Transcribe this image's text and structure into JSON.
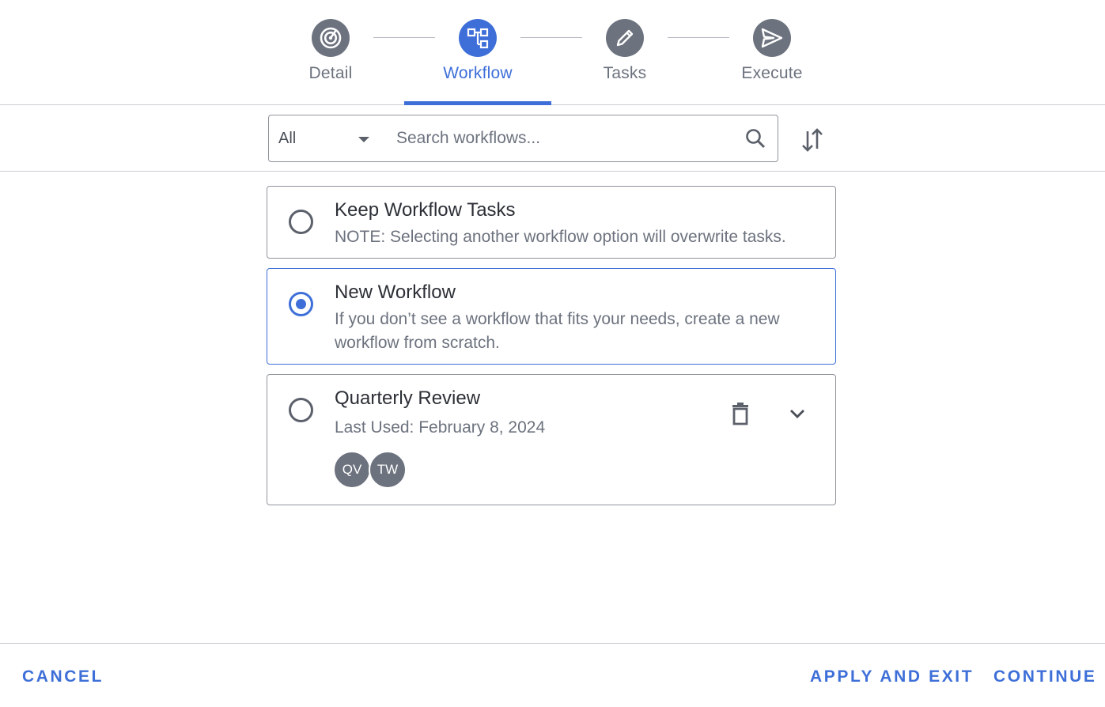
{
  "stepper": {
    "steps": [
      {
        "label": "Detail",
        "icon": "target-icon"
      },
      {
        "label": "Workflow",
        "icon": "workflow-icon"
      },
      {
        "label": "Tasks",
        "icon": "pencil-icon"
      },
      {
        "label": "Execute",
        "icon": "send-icon"
      }
    ],
    "active_step": "Workflow"
  },
  "toolbar": {
    "filter_value": "All",
    "search_placeholder": "Search workflows...",
    "search_value": ""
  },
  "options": [
    {
      "title": "Keep Workflow Tasks",
      "description": "NOTE: Selecting another workflow option will overwrite tasks.",
      "selected": false
    },
    {
      "title": "New Workflow",
      "description": "If you don’t see a workflow that fits your needs, create a new workflow from scratch.",
      "selected": true
    },
    {
      "title": "Quarterly Review",
      "description": "Last Used: February 8, 2024",
      "selected": false,
      "avatars": [
        "QV",
        "TW"
      ]
    }
  ],
  "footer": {
    "cancel_label": "CANCEL",
    "apply_exit_label": "APPLY AND EXIT",
    "continue_label": "CONTINUE"
  },
  "colors": {
    "accent": "#3e6fd8",
    "icon_gray": "#6c727e"
  }
}
